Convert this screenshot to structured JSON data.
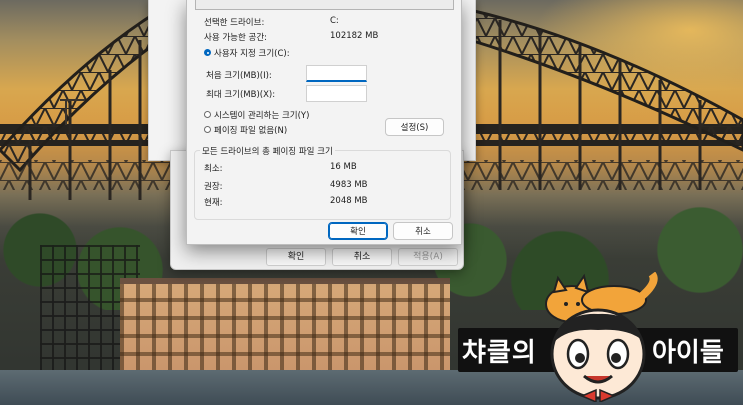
{
  "front_dialog": {
    "selected_drive_label": "선택한 드라이브:",
    "selected_drive_value": "C:",
    "available_space_label": "사용 가능한 공간:",
    "available_space_value": "102182 MB",
    "custom_size_label": "사용자 지정 크기(C):",
    "initial_size_label": "처음 크기(MB)(I):",
    "initial_size_value": "",
    "max_size_label": "최대 크기(MB)(X):",
    "max_size_value": "",
    "system_managed_label": "시스템이 관리하는 크기(Y)",
    "no_paging_label": "페이징 파일 없음(N)",
    "set_button": "설정(S)",
    "total_group_title": "모든 드라이브의 총 페이징 파일 크기",
    "minimum_label": "최소:",
    "minimum_value": "16 MB",
    "recommended_label": "권장:",
    "recommended_value": "4983 MB",
    "current_label": "현재:",
    "current_value": "2048 MB",
    "ok_button": "확인",
    "cancel_button": "취소",
    "selected_option": "custom"
  },
  "back_dialog": {
    "ok_button": "확인",
    "cancel_button": "취소",
    "apply_button": "적용(A)"
  },
  "overlay": {
    "left_text": "챠클의",
    "right_text": "아이들"
  },
  "colors": {
    "accent": "#0067c0",
    "dialog_bg": "#f3f3f3",
    "banner_bg": "#111111"
  }
}
